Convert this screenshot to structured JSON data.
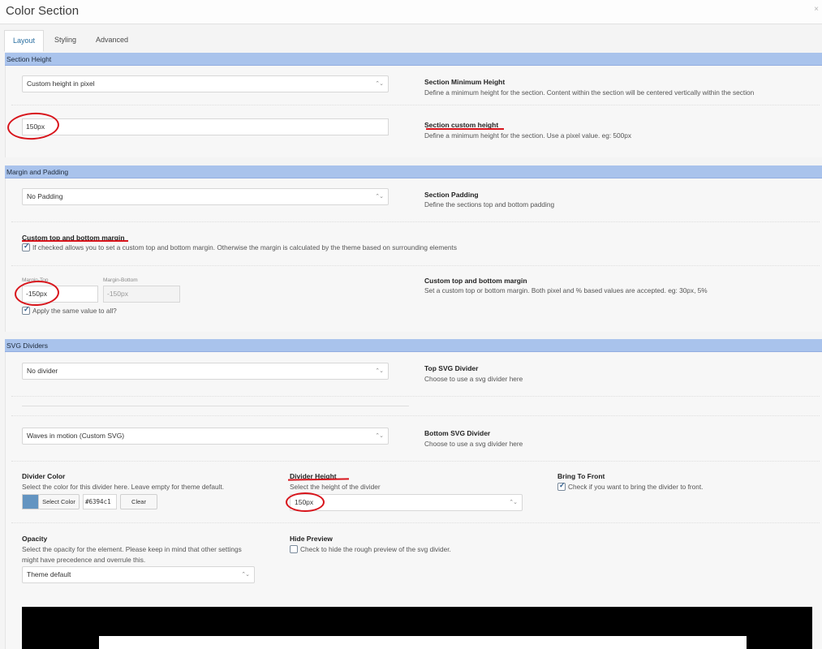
{
  "window": {
    "title": "Color Section",
    "close_glyph": "×"
  },
  "tabs": [
    {
      "label": "Layout",
      "active": true
    },
    {
      "label": "Styling",
      "active": false
    },
    {
      "label": "Advanced",
      "active": false
    }
  ],
  "section_height": {
    "heading": "Section Height",
    "min_height": {
      "value": "Custom height in pixel",
      "label": "Section Minimum Height",
      "desc": "Define a minimum height for the section. Content within the section will be centered vertically within the section"
    },
    "custom_height": {
      "value": "150px",
      "label": "Section custom height",
      "desc": "Define a minimum height for the section. Use a pixel value. eg: 500px"
    }
  },
  "margin_padding": {
    "heading": "Margin and Padding",
    "padding": {
      "value": "No Padding",
      "label": "Section Padding",
      "desc": "Define the sections top and bottom padding"
    },
    "custom_margin": {
      "label": "Custom top and bottom margin",
      "checkbox_text": "If checked allows you to set a custom top and bottom margin. Otherwise the margin is calculated by the theme based on surrounding elements",
      "checked": true
    },
    "margins": {
      "top_label": "Margin-Top",
      "top_value": "-150px",
      "bottom_label": "Margin-Bottom",
      "bottom_placeholder": "-150px",
      "apply_same": "Apply the same value to all?",
      "apply_checked": true,
      "label": "Custom top and bottom margin",
      "desc": "Set a custom top or bottom margin. Both pixel and % based values are accepted. eg: 30px, 5%"
    }
  },
  "svg_dividers": {
    "heading": "SVG Dividers",
    "top": {
      "value": "No divider",
      "label": "Top SVG Divider",
      "desc": "Choose to use a svg divider here"
    },
    "bottom": {
      "value": "Waves in motion (Custom SVG)",
      "label": "Bottom SVG Divider",
      "desc": "Choose to use a svg divider here"
    },
    "color": {
      "label": "Divider Color",
      "desc": "Select the color for this divider here. Leave empty for theme default.",
      "select_btn": "Select Color",
      "hex": "#6394c1",
      "clear_btn": "Clear",
      "swatch": "#6394c1"
    },
    "height": {
      "label": "Divider Height",
      "desc": "Select the height of the divider",
      "value": "150px"
    },
    "front": {
      "label": "Bring To Front",
      "checkbox_text": "Check if you want to bring the divider to front.",
      "checked": true
    },
    "opacity": {
      "label": "Opacity",
      "desc1": "Select the opacity for the element. Please keep in mind that other settings",
      "desc2": "might have precedence and overrule this.",
      "value": "Theme default"
    },
    "preview": {
      "label": "Hide Preview",
      "checkbox_text": "Check to hide the rough preview of the svg divider.",
      "checked": false
    }
  },
  "colors": {
    "section_header": "#a9c3ec",
    "annotation": "#d8141b",
    "active_tab_text": "#2a6fa1"
  }
}
